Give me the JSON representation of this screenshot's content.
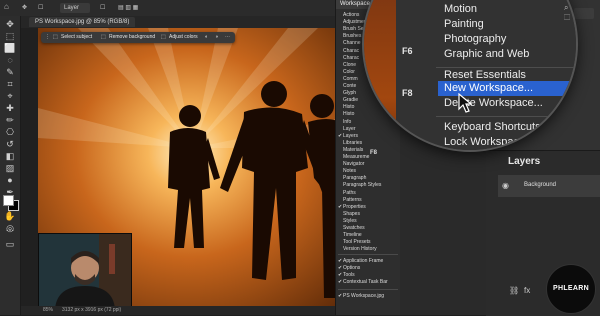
{
  "topbar": {
    "layer_select": "Layer"
  },
  "document": {
    "tab_title": "PS Workspace.jpg @ 85% (RGB/8)",
    "zoom": "85%",
    "dimensions": "3132 px x 3916 px (72 ppi)"
  },
  "taskbar": {
    "select_subject": "Select subject",
    "remove_background": "Remove background",
    "adjust_colors": "Adjust colors"
  },
  "window_menu": {
    "header": "Workspace",
    "items": [
      "Actions",
      "Adjustments",
      "Brush Settings",
      "Brushes",
      "Channels",
      "Character",
      "Character Styles",
      "Clone Source",
      "Color",
      "Comments",
      "Content Credentials",
      "Glyphs",
      "Gradients",
      "Histogram",
      "History",
      "Info",
      "Layer Comps",
      "Layers",
      "Libraries",
      "Materials",
      "Measurement Log",
      "Navigator",
      "Notes",
      "Paragraph",
      "Paragraph Styles",
      "Paths",
      "Patterns",
      "Properties",
      "Shapes",
      "Styles",
      "Swatches",
      "Timeline",
      "Tool Presets",
      "Version History"
    ],
    "visible_labels": [
      "Actions",
      "Adjustments",
      "Brush Setti",
      "Brushes",
      "Channe",
      "Charac",
      "Charac",
      "Clone",
      "Color",
      "Comm",
      "Conte",
      "Glyph",
      "Gradie",
      "Histo",
      "Histo",
      "Info",
      "Layer",
      "Layers",
      "Libraries",
      "Materials",
      "Measureme",
      "Navigator",
      "Notes",
      "Paragraph",
      "Paragraph Styles",
      "Paths",
      "Patterns",
      "Properties",
      "Shapes",
      "Styles",
      "Swatches",
      "Timeline",
      "Tool Presets",
      "Version History"
    ],
    "checked_items": [
      "Layers",
      "Properties"
    ],
    "bottom_items": [
      "Application Frame",
      "Options",
      "Tools",
      "Contextual Task Bar"
    ],
    "document_item": "PS Workspace.jpg",
    "shortcut_f6": "F6",
    "shortcut_f8": "F8"
  },
  "magnified_menu": {
    "items_top": [
      "Motion",
      "Painting",
      "Photography",
      "Graphic and Web"
    ],
    "items_mid": [
      "Reset Essentials",
      "New Workspace...",
      "Delete Workspace..."
    ],
    "items_bottom": [
      "Keyboard Shortcuts & Menus...",
      "Lock Workspace"
    ],
    "highlighted": "New Workspace..."
  },
  "layers_panel": {
    "title": "Layers",
    "background_layer": "Background"
  },
  "watermark": {
    "brand": "PHLEARN"
  },
  "colors": {
    "accent_highlight": "#2a62cf",
    "photo_glow": "#f0a040",
    "panel_bg": "#2a2a2a"
  }
}
